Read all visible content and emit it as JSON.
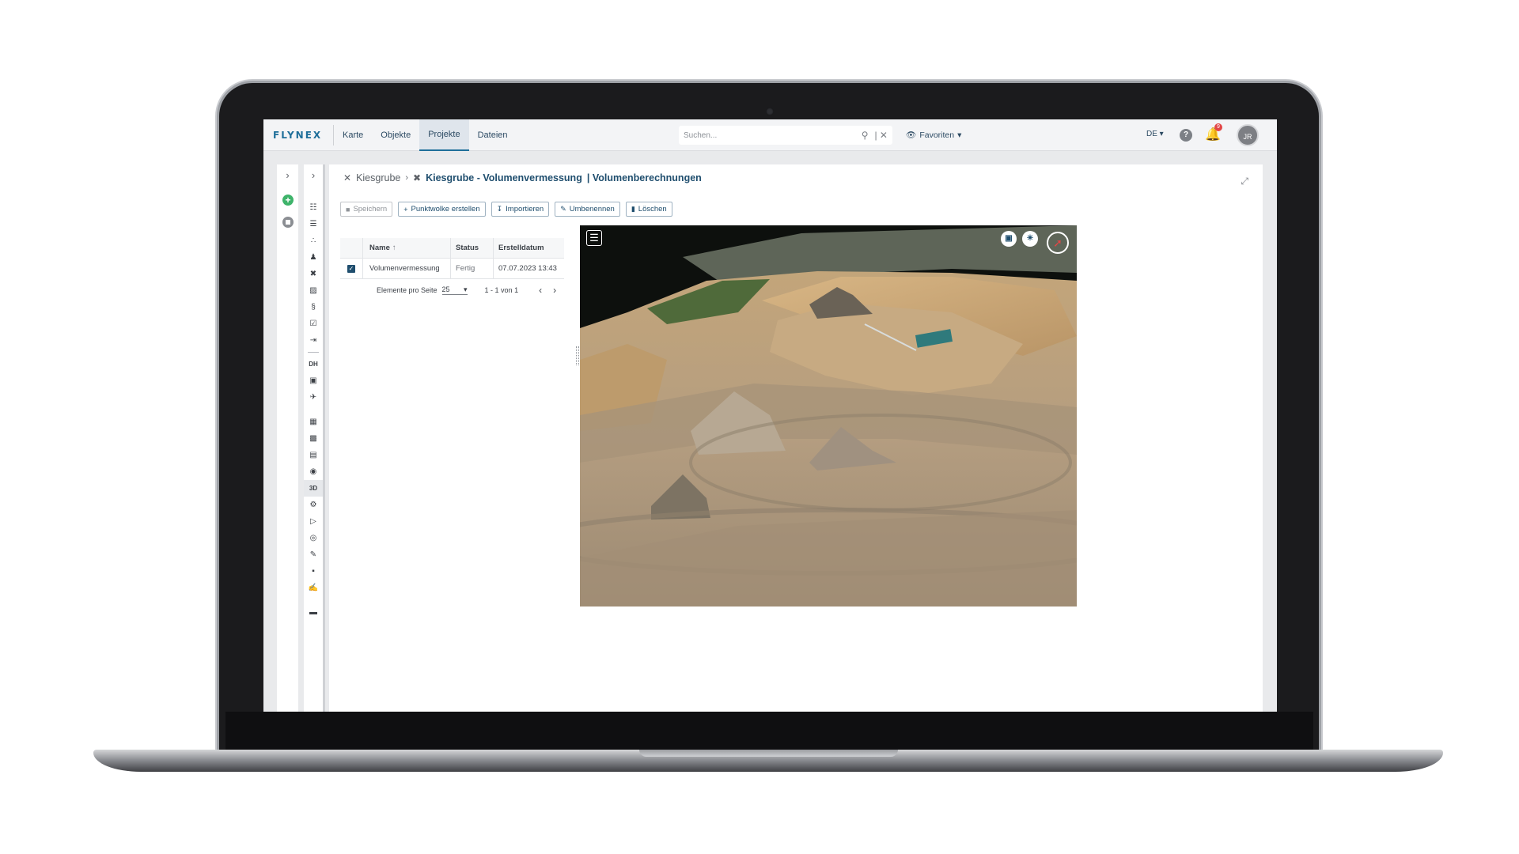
{
  "app": {
    "logo": "FLYNEX",
    "nav": [
      "Karte",
      "Objekte",
      "Projekte",
      "Dateien"
    ],
    "active_nav": "Projekte",
    "search_placeholder": "Suchen...",
    "favorites_label": "Favoriten",
    "language": "DE",
    "notification_count": "9",
    "user_initials": "JR"
  },
  "rail_icons": [
    "hierarchy-icon",
    "list-icon",
    "flow-icon",
    "users-icon",
    "drone-icon",
    "map-icon",
    "paragraph-icon",
    "checklist-icon",
    "export-icon",
    "divider",
    "DH",
    "camera-icon",
    "airplane-icon",
    "gap",
    "calendar-icon",
    "image-icon",
    "grid-icon",
    "photo-icon",
    "3D",
    "settings-icon",
    "path-icon",
    "pin-icon",
    "edit-icon",
    "draw-icon",
    "sign-icon",
    "gap",
    "chat-icon"
  ],
  "breadcrumb": {
    "root": "Kiesgrube",
    "current": "Kiesgrube - Volumenvermessung",
    "sub": "| Volumenberechnungen"
  },
  "toolbar": {
    "save": "Speichern",
    "create_pointcloud": "Punktwolke erstellen",
    "import": "Importieren",
    "rename": "Umbenennen",
    "delete": "Löschen"
  },
  "table": {
    "columns": [
      "Name",
      "Status",
      "Erstelldatum"
    ],
    "rows": [
      {
        "name": "Volumenvermessung",
        "status": "Fertig",
        "date": "07.07.2023 13:43"
      }
    ],
    "pager": {
      "per_page_label": "Elemente pro Seite",
      "per_page": "25",
      "range": "1 - 1 von 1"
    }
  },
  "viewer": {
    "tools": [
      "menu-icon",
      "layers-icon",
      "light-icon",
      "compass-icon"
    ]
  },
  "colors": {
    "brand": "#1f6f9a",
    "primary_text": "#1f4e6e",
    "add_green": "#3eb36a",
    "alert_red": "#e24646"
  }
}
